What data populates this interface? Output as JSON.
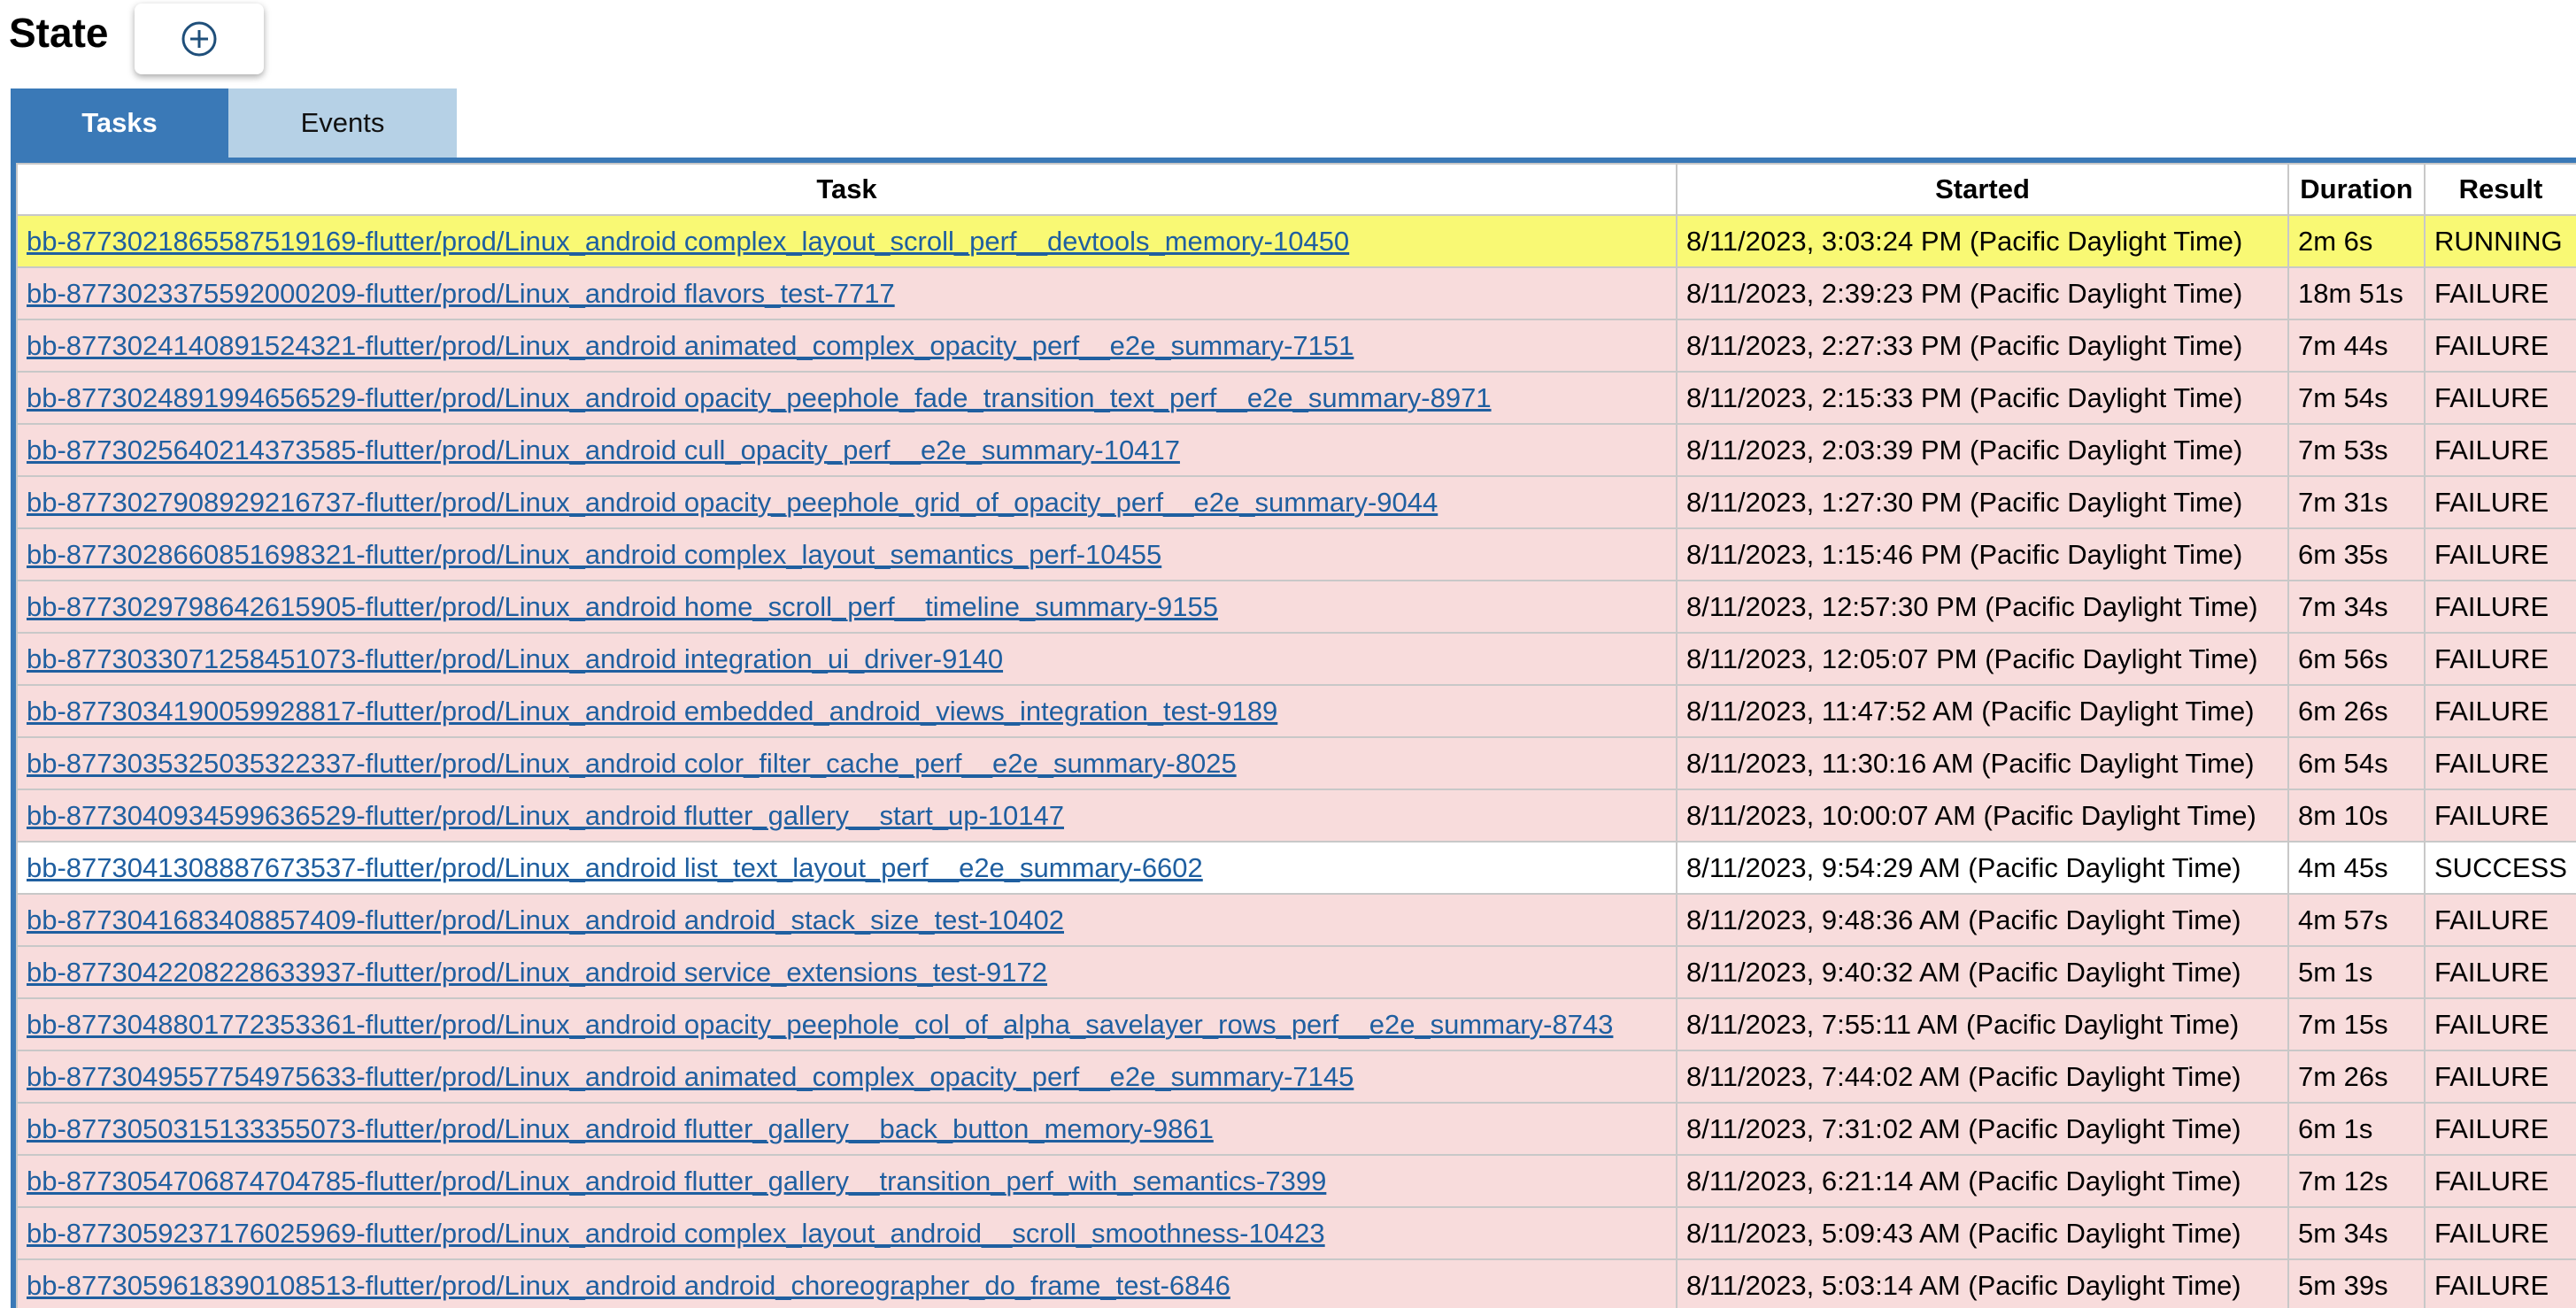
{
  "page": {
    "title": "State"
  },
  "add_button": {
    "icon": "plus-circle-icon"
  },
  "tabs": [
    {
      "label": "Tasks",
      "active": true
    },
    {
      "label": "Events",
      "active": false
    }
  ],
  "colors": {
    "tab_active": "#3a79b7",
    "tab_inactive": "#b6d1e6",
    "running_row": "#f9f974",
    "failure_row": "#f8dcdc",
    "success_row": "#ffffff",
    "link": "#1f5fa0"
  },
  "table": {
    "columns": [
      "Task",
      "Started",
      "Duration",
      "Result"
    ],
    "rows": [
      {
        "task": "bb-8773021865587519169-flutter/prod/Linux_android complex_layout_scroll_perf__devtools_memory-10450",
        "started": "8/11/2023, 3:03:24 PM (Pacific Daylight Time)",
        "duration": "2m 6s",
        "result": "RUNNING",
        "status": "running"
      },
      {
        "task": "bb-8773023375592000209-flutter/prod/Linux_android flavors_test-7717",
        "started": "8/11/2023, 2:39:23 PM (Pacific Daylight Time)",
        "duration": "18m 51s",
        "result": "FAILURE",
        "status": "failure"
      },
      {
        "task": "bb-8773024140891524321-flutter/prod/Linux_android animated_complex_opacity_perf__e2e_summary-7151",
        "started": "8/11/2023, 2:27:33 PM (Pacific Daylight Time)",
        "duration": "7m 44s",
        "result": "FAILURE",
        "status": "failure"
      },
      {
        "task": "bb-8773024891994656529-flutter/prod/Linux_android opacity_peephole_fade_transition_text_perf__e2e_summary-8971",
        "started": "8/11/2023, 2:15:33 PM (Pacific Daylight Time)",
        "duration": "7m 54s",
        "result": "FAILURE",
        "status": "failure"
      },
      {
        "task": "bb-8773025640214373585-flutter/prod/Linux_android cull_opacity_perf__e2e_summary-10417",
        "started": "8/11/2023, 2:03:39 PM (Pacific Daylight Time)",
        "duration": "7m 53s",
        "result": "FAILURE",
        "status": "failure"
      },
      {
        "task": "bb-8773027908929216737-flutter/prod/Linux_android opacity_peephole_grid_of_opacity_perf__e2e_summary-9044",
        "started": "8/11/2023, 1:27:30 PM (Pacific Daylight Time)",
        "duration": "7m 31s",
        "result": "FAILURE",
        "status": "failure"
      },
      {
        "task": "bb-8773028660851698321-flutter/prod/Linux_android complex_layout_semantics_perf-10455",
        "started": "8/11/2023, 1:15:46 PM (Pacific Daylight Time)",
        "duration": "6m 35s",
        "result": "FAILURE",
        "status": "failure"
      },
      {
        "task": "bb-8773029798642615905-flutter/prod/Linux_android home_scroll_perf__timeline_summary-9155",
        "started": "8/11/2023, 12:57:30 PM (Pacific Daylight Time)",
        "duration": "7m 34s",
        "result": "FAILURE",
        "status": "failure"
      },
      {
        "task": "bb-8773033071258451073-flutter/prod/Linux_android integration_ui_driver-9140",
        "started": "8/11/2023, 12:05:07 PM (Pacific Daylight Time)",
        "duration": "6m 56s",
        "result": "FAILURE",
        "status": "failure"
      },
      {
        "task": "bb-8773034190059928817-flutter/prod/Linux_android embedded_android_views_integration_test-9189",
        "started": "8/11/2023, 11:47:52 AM (Pacific Daylight Time)",
        "duration": "6m 26s",
        "result": "FAILURE",
        "status": "failure"
      },
      {
        "task": "bb-8773035325035322337-flutter/prod/Linux_android color_filter_cache_perf__e2e_summary-8025",
        "started": "8/11/2023, 11:30:16 AM (Pacific Daylight Time)",
        "duration": "6m 54s",
        "result": "FAILURE",
        "status": "failure"
      },
      {
        "task": "bb-8773040934599636529-flutter/prod/Linux_android flutter_gallery__start_up-10147",
        "started": "8/11/2023, 10:00:07 AM (Pacific Daylight Time)",
        "duration": "8m 10s",
        "result": "FAILURE",
        "status": "failure"
      },
      {
        "task": "bb-8773041308887673537-flutter/prod/Linux_android list_text_layout_perf__e2e_summary-6602",
        "started": "8/11/2023, 9:54:29 AM (Pacific Daylight Time)",
        "duration": "4m 45s",
        "result": "SUCCESS",
        "status": "success"
      },
      {
        "task": "bb-8773041683408857409-flutter/prod/Linux_android android_stack_size_test-10402",
        "started": "8/11/2023, 9:48:36 AM (Pacific Daylight Time)",
        "duration": "4m 57s",
        "result": "FAILURE",
        "status": "failure"
      },
      {
        "task": "bb-8773042208228633937-flutter/prod/Linux_android service_extensions_test-9172",
        "started": "8/11/2023, 9:40:32 AM (Pacific Daylight Time)",
        "duration": "5m 1s",
        "result": "FAILURE",
        "status": "failure"
      },
      {
        "task": "bb-8773048801772353361-flutter/prod/Linux_android opacity_peephole_col_of_alpha_savelayer_rows_perf__e2e_summary-8743",
        "started": "8/11/2023, 7:55:11 AM (Pacific Daylight Time)",
        "duration": "7m 15s",
        "result": "FAILURE",
        "status": "failure"
      },
      {
        "task": "bb-8773049557754975633-flutter/prod/Linux_android animated_complex_opacity_perf__e2e_summary-7145",
        "started": "8/11/2023, 7:44:02 AM (Pacific Daylight Time)",
        "duration": "7m 26s",
        "result": "FAILURE",
        "status": "failure"
      },
      {
        "task": "bb-8773050315133355073-flutter/prod/Linux_android flutter_gallery__back_button_memory-9861",
        "started": "8/11/2023, 7:31:02 AM (Pacific Daylight Time)",
        "duration": "6m 1s",
        "result": "FAILURE",
        "status": "failure"
      },
      {
        "task": "bb-8773054706874704785-flutter/prod/Linux_android flutter_gallery__transition_perf_with_semantics-7399",
        "started": "8/11/2023, 6:21:14 AM (Pacific Daylight Time)",
        "duration": "7m 12s",
        "result": "FAILURE",
        "status": "failure"
      },
      {
        "task": "bb-8773059237176025969-flutter/prod/Linux_android complex_layout_android__scroll_smoothness-10423",
        "started": "8/11/2023, 5:09:43 AM (Pacific Daylight Time)",
        "duration": "5m 34s",
        "result": "FAILURE",
        "status": "failure"
      },
      {
        "task": "bb-8773059618390108513-flutter/prod/Linux_android android_choreographer_do_frame_test-6846",
        "started": "8/11/2023, 5:03:14 AM (Pacific Daylight Time)",
        "duration": "5m 39s",
        "result": "FAILURE",
        "status": "failure"
      }
    ]
  }
}
